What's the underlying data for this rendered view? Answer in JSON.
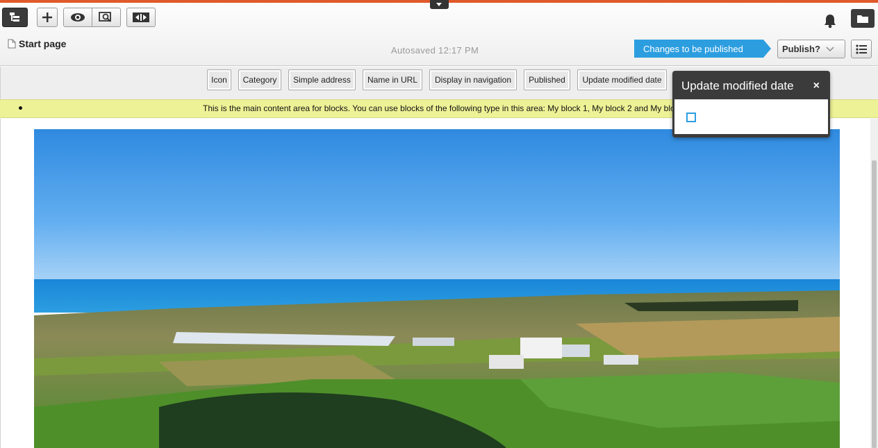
{
  "toolbar": {
    "page_title": "Start page",
    "autosaved": "Autosaved 12:17 PM",
    "changes_badge": "Changes to be published",
    "publish_label": "Publish?"
  },
  "properties": [
    "Icon",
    "Category",
    "Simple address",
    "Name in URL",
    "Display in navigation",
    "Published",
    "Update modified date"
  ],
  "content_area": {
    "message": "This is the main content area for blocks. You can use blocks of the following type in this area: My block 1, My block 2 and My block 3"
  },
  "popover": {
    "title": "Update modified date",
    "close_glyph": "×"
  },
  "colors": {
    "accent": "#e05a2b",
    "badge": "#2c9ee0",
    "dark_button": "#3b3b3b",
    "notice_bg": "#eef296"
  }
}
